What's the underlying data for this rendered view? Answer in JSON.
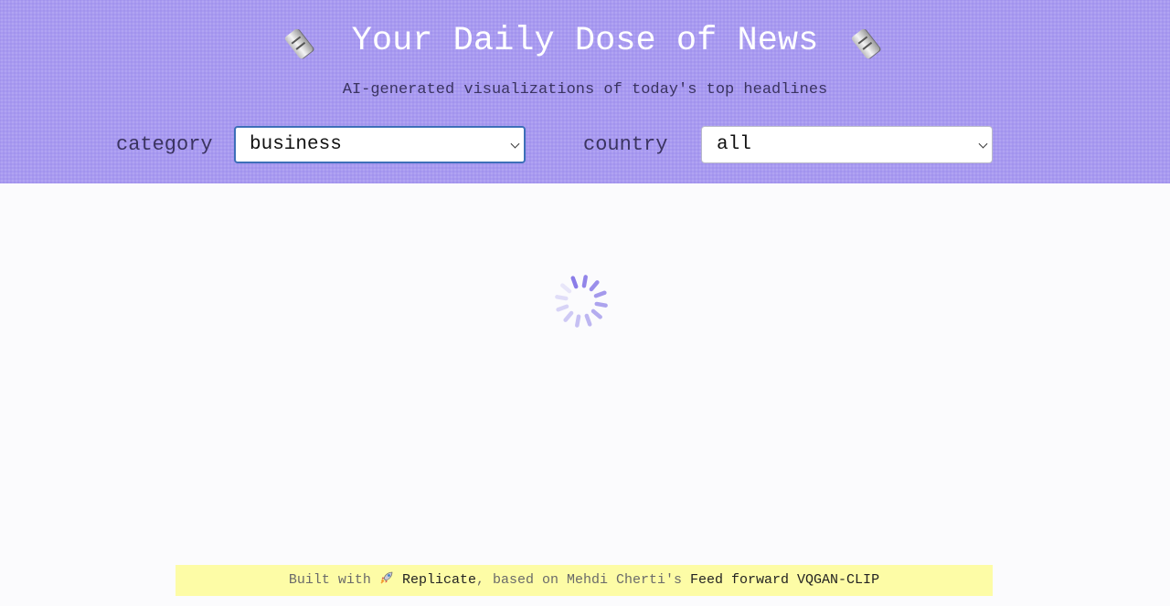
{
  "header": {
    "title": "Your Daily Dose of News",
    "subtitle": "AI-generated visualizations of today's top headlines",
    "icon": "rolled-newspaper-icon",
    "background_color": "#a89af0"
  },
  "filters": {
    "category": {
      "label": "category",
      "selected": "business"
    },
    "country": {
      "label": "country",
      "selected": "all"
    }
  },
  "main": {
    "loading": true,
    "spinner_color": "#8a7ce8"
  },
  "footer": {
    "prefix": "Built with",
    "icon": "rocket-icon",
    "replicate_link": "Replicate",
    "middle": ", based on Mehdi Cherti's",
    "model_link": "Feed forward VQGAN-CLIP",
    "background_color": "#fdfca6"
  }
}
